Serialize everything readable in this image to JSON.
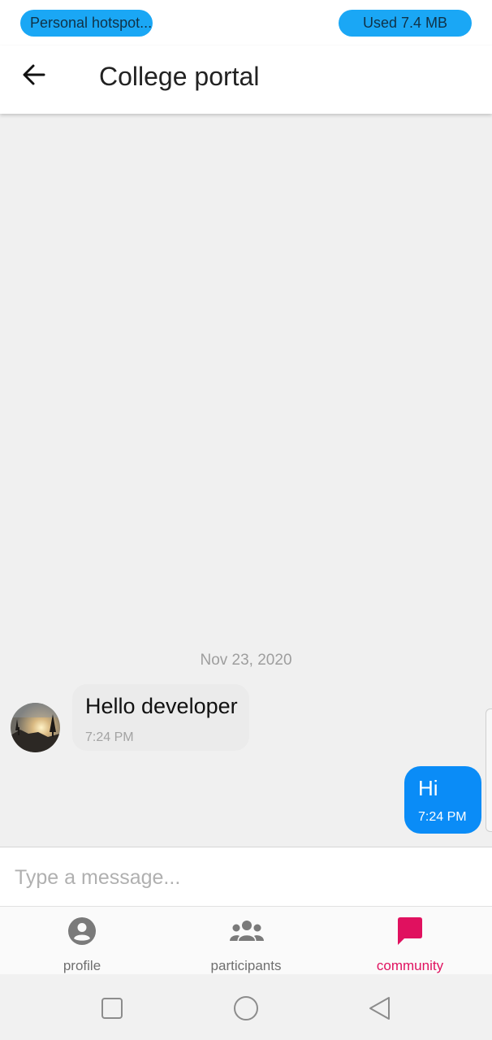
{
  "status_bar": {
    "hotspot_label": "Personal hotspot...",
    "data_usage_label": "Used  7.4 MB",
    "pill_color": "#1aa7f5"
  },
  "header": {
    "back_icon": "arrow-left-icon",
    "title": "College portal"
  },
  "chat": {
    "date_separator": "Nov 23, 2020",
    "messages": [
      {
        "direction": "incoming",
        "text": "Hello developer",
        "time": "7:24 PM",
        "avatar_icon": "user-avatar"
      },
      {
        "direction": "outgoing",
        "text": "Hi",
        "time": "7:24 PM"
      }
    ],
    "outgoing_bubble_color": "#0a8cf7",
    "incoming_bubble_color": "#ebebeb"
  },
  "composer": {
    "placeholder": "Type a message...",
    "value": ""
  },
  "bottom_nav": {
    "items": [
      {
        "label": "profile",
        "icon": "account-circle-icon",
        "active": false
      },
      {
        "label": "participants",
        "icon": "group-icon",
        "active": false
      },
      {
        "label": "community",
        "icon": "chat-bubble-icon",
        "active": true
      }
    ],
    "active_color": "#e0115f",
    "inactive_color": "#6f6f6f"
  },
  "system_nav": {
    "buttons": [
      "recents-square-icon",
      "home-circle-icon",
      "back-triangle-icon"
    ]
  }
}
